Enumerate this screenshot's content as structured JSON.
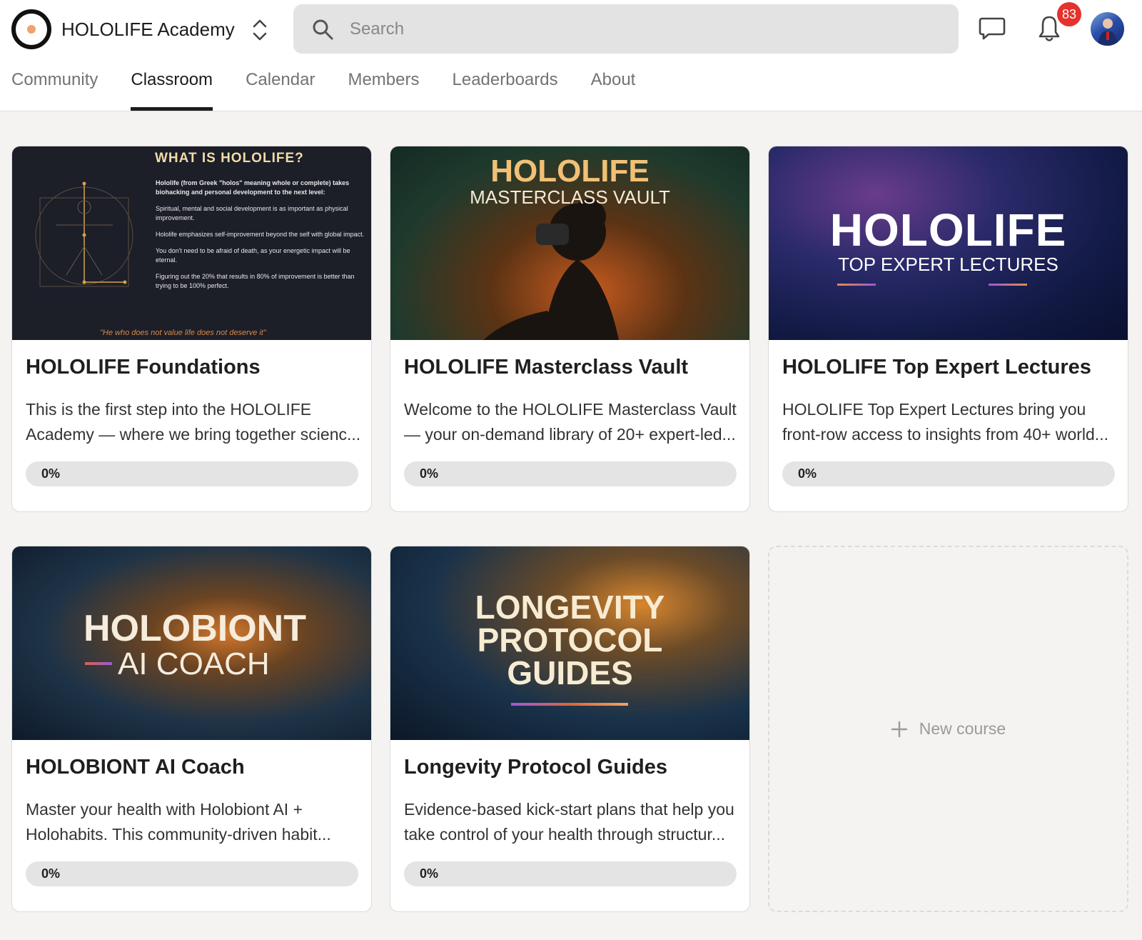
{
  "header": {
    "brand_name": "HOLOLIFE Academy",
    "search_placeholder": "Search",
    "notification_count": "83"
  },
  "tabs": [
    {
      "label": "Community",
      "active": false
    },
    {
      "label": "Classroom",
      "active": true
    },
    {
      "label": "Calendar",
      "active": false
    },
    {
      "label": "Members",
      "active": false
    },
    {
      "label": "Leaderboards",
      "active": false
    },
    {
      "label": "About",
      "active": false
    }
  ],
  "courses": [
    {
      "title": "HOLOLIFE Foundations",
      "description_line1": "This is the first step into the HOLOLIFE",
      "description_line2": "Academy — where we bring together scienc...",
      "progress_label": "0%",
      "progress": 0,
      "cover": {
        "heading": "WHAT IS HOLOLIFE?",
        "p1": "Hololife (from Greek \"holos\" meaning whole or complete) takes biohacking and personal development to the next level:",
        "p2": "Spiritual, mental and social development is as important as physical improvement.",
        "p3": "Hololife emphasizes self-improvement beyond the self with global impact.",
        "p4": "You don't need to be afraid of death, as your energetic impact will be eternal.",
        "p5": "Figuring out the 20% that results in 80% of improvement is better than trying to be 100% perfect.",
        "quote": "\"He who does not value life does not deserve it\""
      }
    },
    {
      "title": "HOLOLIFE Masterclass Vault",
      "description_line1": "Welcome to the HOLOLIFE Masterclass Vault",
      "description_line2": "— your on-demand library of 20+ expert-led...",
      "progress_label": "0%",
      "progress": 0,
      "cover": {
        "line1": "HOLOLIFE",
        "line2": "MASTERCLASS VAULT"
      }
    },
    {
      "title": "HOLOLIFE Top Expert Lectures",
      "description_line1": "HOLOLIFE Top Expert Lectures bring you",
      "description_line2": "front-row access to insights from 40+ world...",
      "progress_label": "0%",
      "progress": 0,
      "cover": {
        "line1": "HOLOLIFE",
        "line2": "TOP EXPERT LECTURES"
      }
    },
    {
      "title": "HOLOBIONT AI Coach",
      "description_line1": "Master your health with Holobiont AI +",
      "description_line2": "Holohabits. This community-driven habit...",
      "progress_label": "0%",
      "progress": 0,
      "cover": {
        "line1": "HOLOBIONT",
        "line2": "AI COACH"
      }
    },
    {
      "title": "Longevity Protocol Guides",
      "description_line1": "Evidence-based kick-start plans that help you",
      "description_line2": "take control of your health through structur...",
      "progress_label": "0%",
      "progress": 0,
      "cover": {
        "line1": "LONGEVITY",
        "line2": "PROTOCOL",
        "line3": "GUIDES"
      }
    }
  ],
  "new_course_label": "New course",
  "colors": {
    "accent": "#f0a26b",
    "badge": "#e5322e",
    "active_tab": "#1c1c1c",
    "inactive_tab": "#737373",
    "page_background": "#f4f3f1"
  },
  "icons": [
    "logo-icon",
    "chevron-up-down-icon",
    "search-icon",
    "chat-icon",
    "bell-icon",
    "plus-icon"
  ]
}
